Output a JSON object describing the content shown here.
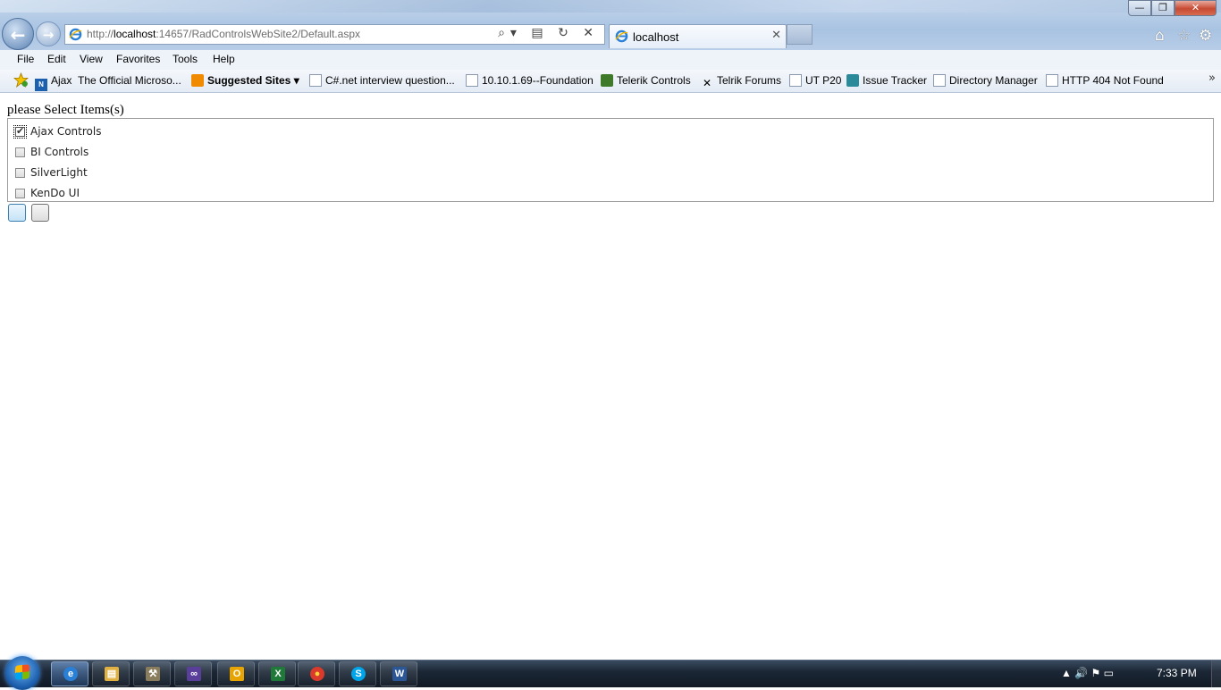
{
  "window": {
    "minimize_label": "—",
    "maximize_label": "❐",
    "close_label": "✕"
  },
  "browser": {
    "address": {
      "prefix": "http://",
      "host": "localhost",
      "rest": ":14657/RadControlsWebSite2/Default.aspx"
    },
    "tab_title": "localhost",
    "tab_close": "✕",
    "back_glyph": "←",
    "forward_glyph": "→",
    "addr_buttons": "⌕▾ ▤ ↻ ✕",
    "home_glyph": "⌂",
    "star_glyph": "☆",
    "gear_glyph": "⚙"
  },
  "menu": [
    "File",
    "Edit",
    "View",
    "Favorites",
    "Tools",
    "Help"
  ],
  "favorites": [
    {
      "label": "Ajax",
      "icon": "aspnet-icon"
    },
    {
      "label": "The Official Microso...",
      "icon": "none"
    },
    {
      "label": "Suggested Sites ▾",
      "icon": "suggested-sites-icon",
      "bold": true
    },
    {
      "label": "C#.net interview question...",
      "icon": "ie-page-icon"
    },
    {
      "label": "10.10.1.69--Foundation",
      "icon": "ie-page-icon"
    },
    {
      "label": "Telerik Controls",
      "icon": "telerik-icon"
    },
    {
      "label": "Telrik Forums",
      "icon": "telerik-forums-icon"
    },
    {
      "label": "UT P20",
      "icon": "ie-page-icon"
    },
    {
      "label": "Issue Tracker",
      "icon": "tracker-icon"
    },
    {
      "label": "Directory Manager",
      "icon": "ie-page-icon"
    },
    {
      "label": "HTTP 404 Not Found",
      "icon": "ie-page-icon"
    }
  ],
  "favorites_more": "»",
  "page": {
    "heading": "please Select Items(s)",
    "items": [
      {
        "label": "Ajax Controls",
        "checked": true
      },
      {
        "label": "BI Controls",
        "checked": false
      },
      {
        "label": "SilverLight",
        "checked": false
      },
      {
        "label": "KenDo UI",
        "checked": false
      }
    ]
  },
  "taskbar": {
    "apps": [
      {
        "name": "internet-explorer",
        "glyph": "e",
        "color": "#2a7fd6",
        "active": true
      },
      {
        "name": "windows-explorer",
        "glyph": "▤",
        "color": "#e0b040"
      },
      {
        "name": "visual-studio-tools",
        "glyph": "⚒",
        "color": "#8a7d5c"
      },
      {
        "name": "visual-studio",
        "glyph": "∞",
        "color": "#5a3f9a"
      },
      {
        "name": "outlook",
        "glyph": "O",
        "color": "#e8a400"
      },
      {
        "name": "excel",
        "glyph": "X",
        "color": "#1f7a3a"
      },
      {
        "name": "chrome",
        "glyph": "●",
        "color": "#d93a2b"
      },
      {
        "name": "skype",
        "glyph": "S",
        "color": "#00a4e8"
      },
      {
        "name": "word",
        "glyph": "W",
        "color": "#2b5797"
      }
    ],
    "tray_glyphs": "▲  🔊  ⚑  ▭",
    "clock": "7:33 PM"
  }
}
